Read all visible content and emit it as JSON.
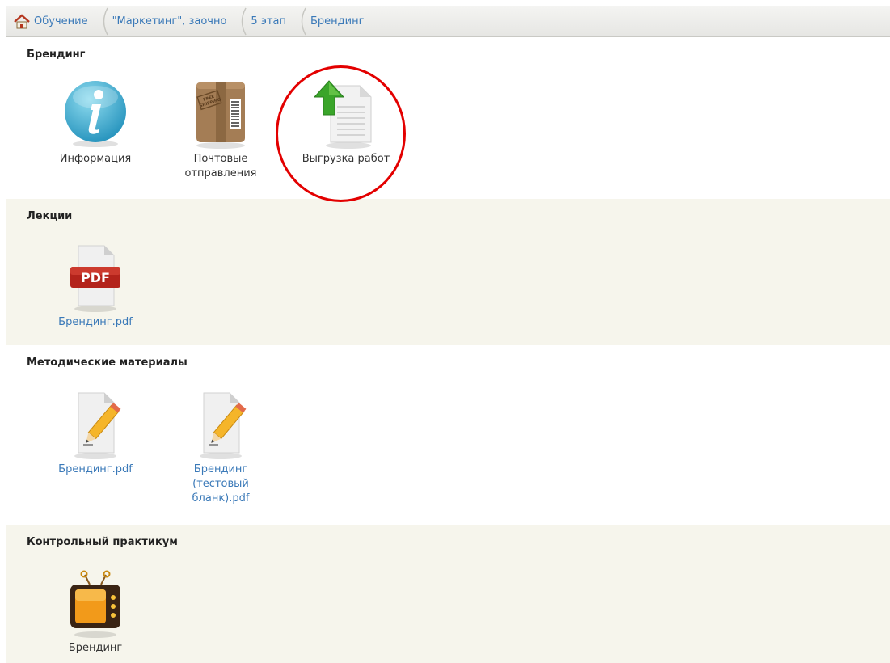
{
  "breadcrumb": {
    "items": [
      {
        "label": "Обучение"
      },
      {
        "label": "\"Маркетинг\", заочно"
      },
      {
        "label": "5 этап"
      },
      {
        "label": "Брендинг"
      }
    ]
  },
  "sections": [
    {
      "title": "Брендинг",
      "items": [
        {
          "label": "Информация",
          "icon": "info-icon"
        },
        {
          "label": "Почтовые отправления",
          "icon": "parcel-box-icon",
          "box_text": "FREE SHIPPING"
        },
        {
          "label": "Выгрузка работ",
          "icon": "upload-document-icon"
        }
      ]
    },
    {
      "title": "Лекции",
      "items": [
        {
          "label": "Брендинг.pdf",
          "icon": "pdf-file-icon",
          "badge": "PDF"
        }
      ]
    },
    {
      "title": "Методические материалы",
      "items": [
        {
          "label": "Брендинг.pdf",
          "icon": "edit-document-icon"
        },
        {
          "label": "Брендинг (тестовый бланк).pdf",
          "icon": "edit-document-icon"
        }
      ]
    },
    {
      "title": "Контрольный практикум",
      "items": [
        {
          "label": "Брендинг",
          "icon": "tv-icon"
        }
      ]
    }
  ],
  "colors": {
    "link": "#3a79b8",
    "section_alt_bg": "#f6f5ec",
    "highlight": "#e30000"
  }
}
